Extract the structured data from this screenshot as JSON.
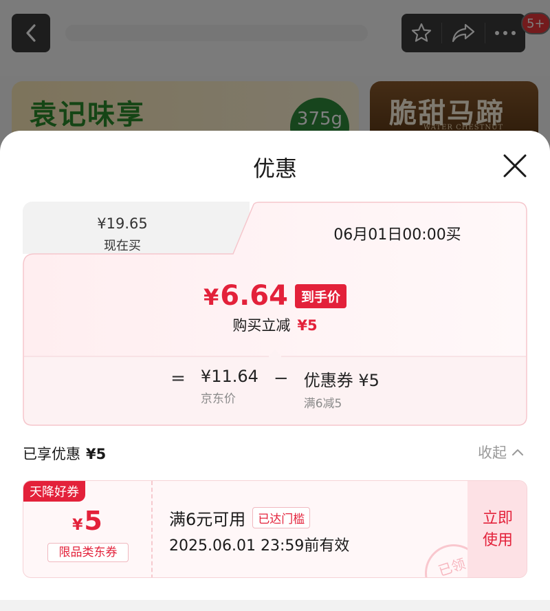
{
  "background": {
    "notification_badge": "5+",
    "banner_left": {
      "brand": "袁记味享",
      "weight": "375g"
    },
    "banner_right": {
      "brand": "脆甜马蹄",
      "sub": "WATER CHESTNUT"
    }
  },
  "sheet": {
    "title": "优惠",
    "tabs": {
      "now": {
        "price": "¥19.65",
        "label": "现在买"
      },
      "later": {
        "label": "06月01日00:00买"
      }
    },
    "final": {
      "yen": "¥",
      "amount": "6.64",
      "tag": "到手价"
    },
    "reduction": {
      "label": "购买立减",
      "amount": "¥5"
    },
    "calc": {
      "eq": "=",
      "minus": "−",
      "jd_price": "¥11.64",
      "jd_label": "京东价",
      "coupon": "优惠券 ¥5",
      "coupon_rule": "满6减5"
    },
    "enjoyed": {
      "label": "已享优惠",
      "amount": "¥5"
    },
    "collapse_label": "收起",
    "coupon": {
      "flag": "天降好券",
      "yen": "¥",
      "amount": "5",
      "type": "限品类东券",
      "condition": "满6元可用",
      "met_badge": "已达门槛",
      "validity": "2025.06.01 23:59前有效",
      "use_line1": "立即",
      "use_line2": "使用",
      "stamp": "已领"
    }
  },
  "colors": {
    "accent": "#e3213a",
    "coupon_bg": "#fff7f8",
    "tab_bg": "#f2f2f2"
  }
}
